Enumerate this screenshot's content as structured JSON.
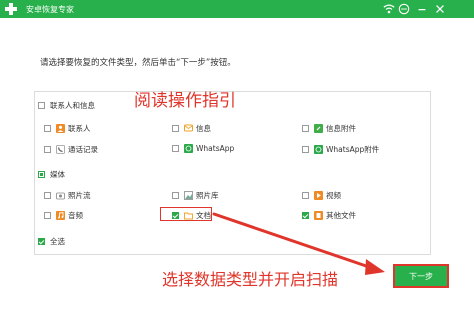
{
  "app": {
    "title": "安卓恢复专家"
  },
  "colors": {
    "brand": "#27b04b",
    "annotation": "#e0352b"
  },
  "instruction": "请选择要恢复的文件类型，然后单击“下一步”按钮。",
  "annotations": {
    "read_guide": "阅读操作指引",
    "select_types": "选择数据类型并开启扫描"
  },
  "groups": {
    "contacts": {
      "label": "联系人和信息",
      "checked": false,
      "items": {
        "contacts": "联系人",
        "messages": "信息",
        "message_attachments": "信息附件",
        "call_log": "通话记录",
        "whatsapp": "WhatsApp",
        "whatsapp_attachments": "WhatsApp附件"
      }
    },
    "media": {
      "label": "媒体",
      "state": "partial",
      "items": {
        "camera": "照片流",
        "gallery": "照片库",
        "video": "视频",
        "audio": "音频",
        "documents": "文档",
        "other_files": "其他文件"
      },
      "checked_items": [
        "文档",
        "其他文件"
      ]
    },
    "select_all": {
      "label": "全选",
      "checked": true
    }
  },
  "buttons": {
    "next": "下一步"
  },
  "icons": {
    "logo": "plus-icon",
    "wifi": "wifi-icon",
    "feedback": "chat-icon",
    "minimize": "minimize-icon",
    "close": "close-icon"
  }
}
